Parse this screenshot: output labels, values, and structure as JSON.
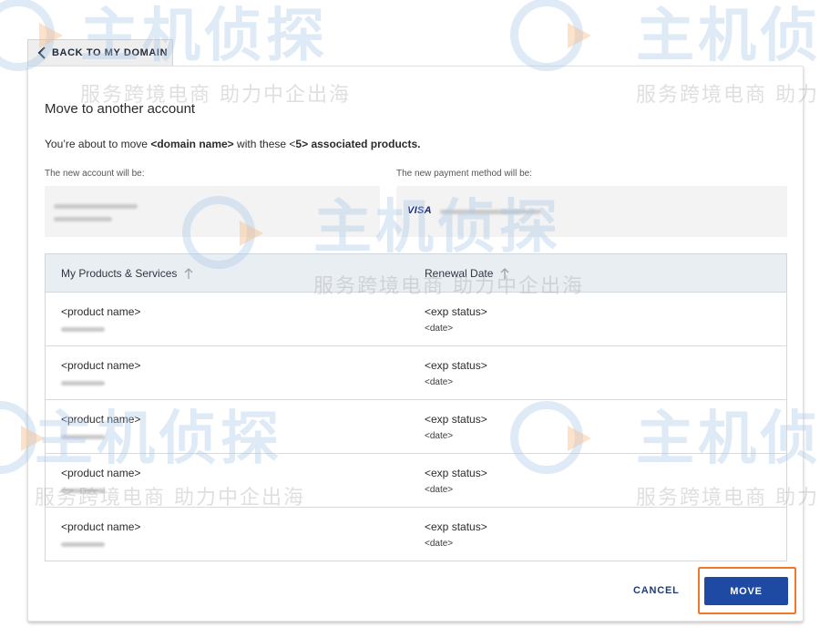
{
  "nav": {
    "back_label": "BACK TO MY DOMAIN"
  },
  "dialog": {
    "title": "Move to another account",
    "intro": {
      "prefix": "You’re about to move ",
      "domain": "<domain name>",
      "middle": " with these ",
      "count_open": "<",
      "count": "5",
      "count_close": ">",
      "suffix": " associated products."
    },
    "new_account_label": "The new account will be:",
    "new_payment_label": "The new payment method will be:",
    "card_brand": "VISA"
  },
  "table": {
    "columns": [
      "My Products & Services",
      "Renewal Date"
    ],
    "rows": [
      {
        "product": "<product name>",
        "status": "<exp status>",
        "date": "<date>"
      },
      {
        "product": "<product name>",
        "status": "<exp status>",
        "date": "<date>"
      },
      {
        "product": "<product name>",
        "status": "<exp status>",
        "date": "<date>"
      },
      {
        "product": "<product name>",
        "status": "<exp status>",
        "date": "<date>"
      },
      {
        "product": "<product name>",
        "status": "<exp status>",
        "date": "<date>"
      }
    ]
  },
  "actions": {
    "cancel_label": "CANCEL",
    "move_label": "MOVE"
  },
  "watermark": {
    "logo": "主机侦探",
    "tagline": "服务跨境电商 助力中企出海"
  },
  "colors": {
    "primary": "#1f4aa3",
    "highlight": "#f07a2a",
    "table_header": "#e9eef2"
  }
}
